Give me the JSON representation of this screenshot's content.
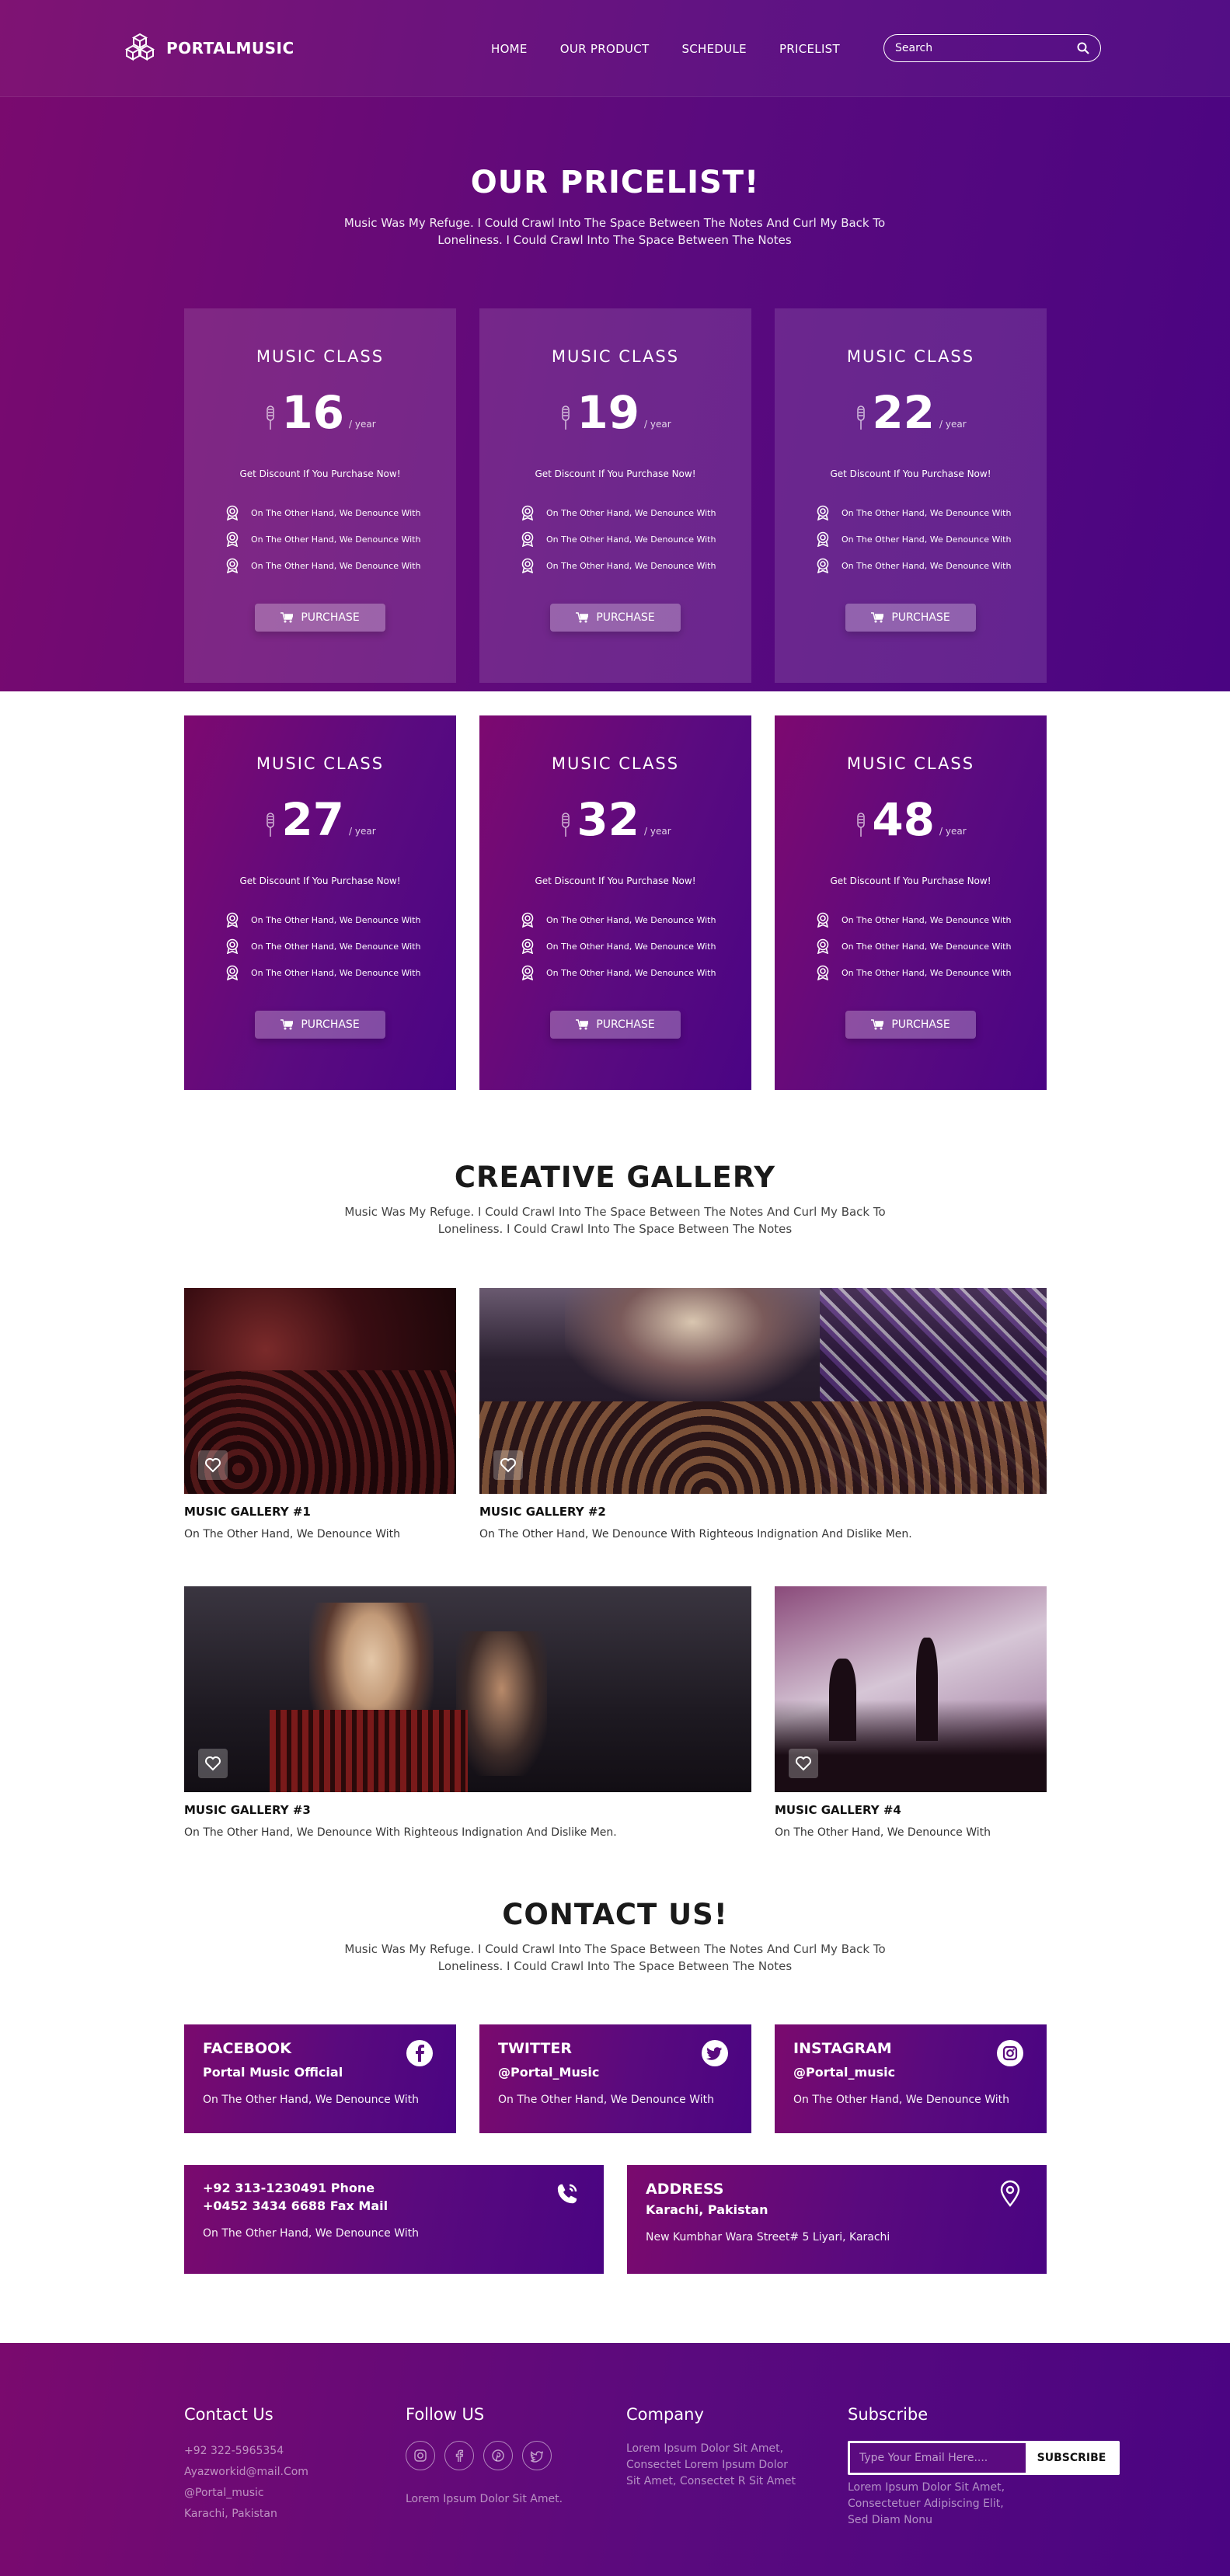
{
  "nav": {
    "logo": "PORTALMUSIC",
    "links": [
      "HOME",
      "OUR PRODUCT",
      "SCHEDULE",
      "PRICELIST"
    ],
    "search_placeholder": "Search"
  },
  "hero": {
    "title": "OUR PRICELIST!",
    "subtitle": "Music Was My Refuge. I Could Crawl Into The Space Between The Notes And Curl My Back To Loneliness. I Could Crawl Into The Space Between The Notes"
  },
  "pricing": {
    "plans": [
      {
        "title": "MUSIC CLASS",
        "price": "16",
        "period": "/ year"
      },
      {
        "title": "MUSIC CLASS",
        "price": "19",
        "period": "/ year"
      },
      {
        "title": "MUSIC CLASS",
        "price": "22",
        "period": "/ year"
      },
      {
        "title": "MUSIC CLASS",
        "price": "27",
        "period": "/ year"
      },
      {
        "title": "MUSIC CLASS",
        "price": "32",
        "period": "/ year"
      },
      {
        "title": "MUSIC CLASS",
        "price": "48",
        "period": "/ year"
      }
    ],
    "discount": "Get Discount If You Purchase Now!",
    "feature": "On The Other Hand, We Denounce With",
    "button": "PURCHASE"
  },
  "gallery": {
    "title": "CREATIVE GALLERY",
    "subtitle": "Music Was My Refuge. I Could Crawl Into The Space Between The Notes And Curl My Back To Loneliness. I Could Crawl Into The Space Between The Notes",
    "items": [
      {
        "name": "MUSIC GALLERY #1",
        "desc": "On The Other Hand, We Denounce With"
      },
      {
        "name": "MUSIC GALLERY #2",
        "desc": "On The Other Hand, We Denounce With Righteous Indignation And Dislike Men."
      },
      {
        "name": "MUSIC GALLERY #3",
        "desc": "On The Other Hand, We Denounce With Righteous Indignation And Dislike Men."
      },
      {
        "name": "MUSIC GALLERY #4",
        "desc": "On The Other Hand, We Denounce With"
      }
    ]
  },
  "contact": {
    "title": "CONTACT US!",
    "subtitle": "Music Was My Refuge. I Could Crawl Into The Space Between The Notes And Curl My Back To Loneliness. I Could Crawl Into The Space Between The Notes",
    "facebook": {
      "head": "FACEBOOK",
      "sub": "Portal Music Official",
      "text": "On The Other Hand, We Denounce With"
    },
    "twitter": {
      "head": "TWITTER",
      "sub": "@Portal_Music",
      "text": "On The Other Hand, We Denounce With"
    },
    "instagram": {
      "head": "INSTAGRAM",
      "sub": "@Portal_music",
      "text": "On The Other Hand, We Denounce With"
    },
    "phone": {
      "line1": "+92 313-1230491 Phone",
      "line2": "+0452 3434 6688 Fax Mail",
      "text": "On The Other Hand, We Denounce With"
    },
    "address": {
      "head": "ADDRESS",
      "sub": "Karachi, Pakistan",
      "text": "New Kumbhar Wara Street# 5 Liyari, Karachi"
    }
  },
  "footer": {
    "contact_head": "Contact Us",
    "contact_lines": [
      "+92 322-5965354",
      "Ayazworkid@mail.Com",
      "@Portal_music",
      "Karachi, Pakistan"
    ],
    "follow_head": "Follow US",
    "follow_text": "Lorem Ipsum Dolor Sit Amet.",
    "company_head": "Company",
    "company_text": [
      "Lorem Ipsum Dolor Sit Amet,",
      "Consectet Lorem Ipsum Dolor",
      "Sit Amet, Consectet R Sit Amet"
    ],
    "subscribe_head": "Subscribe",
    "subscribe_placeholder": "Type Your Email Here....",
    "subscribe_button": "SUBSCRIBE",
    "subscribe_text": [
      "Lorem Ipsum Dolor Sit Amet,",
      "Consectetuer Adipiscing Elit,",
      "Sed Diam Nonu"
    ]
  }
}
